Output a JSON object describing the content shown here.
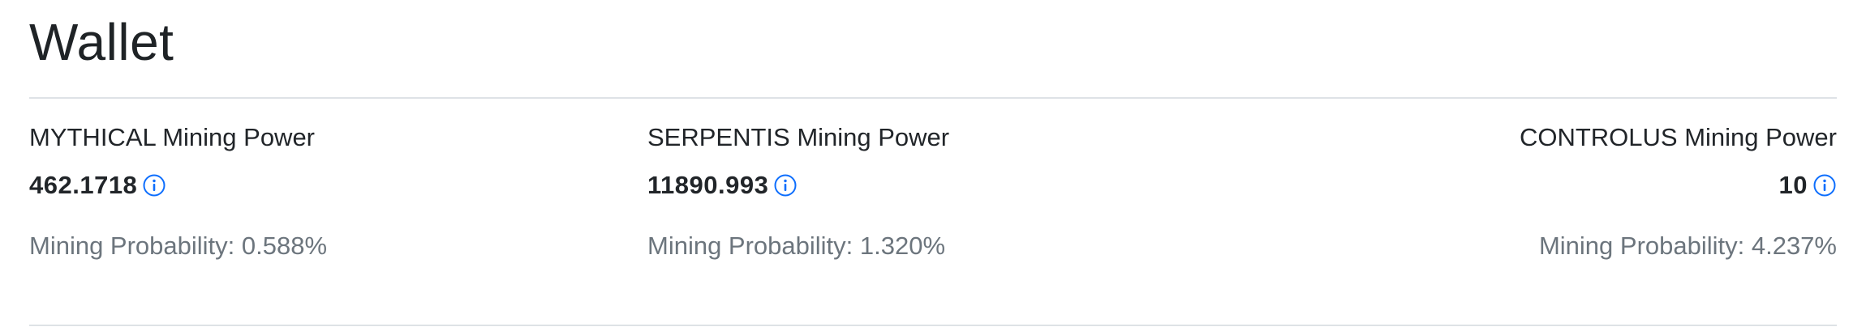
{
  "page": {
    "title": "Wallet"
  },
  "stats": [
    {
      "label": "MYTHICAL Mining Power",
      "value": "462.1718",
      "info_icon": "info-circle-icon",
      "probability": "Mining Probability: 0.588%"
    },
    {
      "label": "SERPENTIS Mining Power",
      "value": "11890.993",
      "info_icon": "info-circle-icon",
      "probability": "Mining Probability: 1.320%"
    },
    {
      "label": "CONTROLUS Mining Power",
      "value": "10",
      "info_icon": "info-circle-icon",
      "probability": "Mining Probability: 4.237%"
    }
  ],
  "colors": {
    "text": "#212529",
    "muted": "#6c757d",
    "accent": "#0d6efd",
    "divider": "#dee2e6"
  }
}
